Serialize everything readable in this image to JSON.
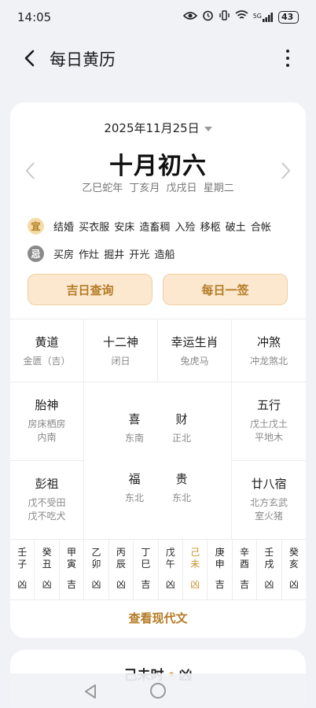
{
  "status_bar": {
    "time": "14:05",
    "network": "5G",
    "battery": "43"
  },
  "app_bar": {
    "title": "每日黄历"
  },
  "date": {
    "solar": "2025年11月25日",
    "lunar": "十月初六",
    "ganzhi": "乙巳蛇年  丁亥月  戊戌日  星期二"
  },
  "yi": {
    "badge": "宜",
    "text": "结婚 买衣服 安床 造畜稠 入殓 移柩 破土 合帐"
  },
  "ji": {
    "badge": "忌",
    "text": "买房 作灶 掘井 开光 造船"
  },
  "buttons": {
    "jiri": "吉日查询",
    "qian": "每日一签"
  },
  "grid": {
    "huangdao": {
      "title": "黄道",
      "value": "金匮（吉）"
    },
    "shiershen": {
      "title": "十二神",
      "value": "闭日"
    },
    "xingyun": {
      "title": "幸运生肖",
      "value": "兔虎马"
    },
    "chongsha": {
      "title": "冲煞",
      "value": "冲龙煞北"
    },
    "taishen": {
      "title": "胎神",
      "value1": "房床栖房",
      "value2": "内南"
    },
    "wuxing": {
      "title": "五行",
      "value1": "戊土戊土",
      "value2": "平地木"
    },
    "pengzu": {
      "title": "彭祖",
      "value1": "戊不受田",
      "value2": "戊不吃犬"
    },
    "ershiba": {
      "title": "廿八宿",
      "value1": "北方玄武",
      "value2": "室火猪"
    },
    "gods": {
      "xi": {
        "title": "喜",
        "value": "东南"
      },
      "cai": {
        "title": "财",
        "value": "正北"
      },
      "fu": {
        "title": "福",
        "value": "东北"
      },
      "gui": {
        "title": "贵",
        "value": "东北"
      }
    }
  },
  "hours": [
    {
      "c1": "壬",
      "c2": "子",
      "luck": "凶"
    },
    {
      "c1": "癸",
      "c2": "丑",
      "luck": "凶"
    },
    {
      "c1": "甲",
      "c2": "寅",
      "luck": "吉"
    },
    {
      "c1": "乙",
      "c2": "卯",
      "luck": "凶"
    },
    {
      "c1": "丙",
      "c2": "辰",
      "luck": "凶"
    },
    {
      "c1": "丁",
      "c2": "巳",
      "luck": "吉"
    },
    {
      "c1": "戊",
      "c2": "午",
      "luck": "凶"
    },
    {
      "c1": "己",
      "c2": "未",
      "luck": "凶"
    },
    {
      "c1": "庚",
      "c2": "申",
      "luck": "吉"
    },
    {
      "c1": "辛",
      "c2": "酉",
      "luck": "吉"
    },
    {
      "c1": "壬",
      "c2": "戌",
      "luck": "凶"
    },
    {
      "c1": "癸",
      "c2": "亥",
      "luck": "凶"
    }
  ],
  "active_hour_index": 7,
  "modern_link": "查看现代文",
  "next_card": {
    "hour": "己未时",
    "dot": "•",
    "luck": "凶"
  },
  "colors": {
    "accent": "#b47b25",
    "active_hour": "#c9912f",
    "button_bg": "#fbe8cf"
  }
}
